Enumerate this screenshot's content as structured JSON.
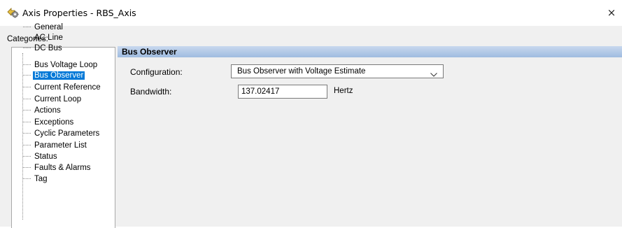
{
  "window": {
    "title": "Axis Properties - RBS_Axis",
    "close_glyph": "×",
    "icon": "axis-properties-icon"
  },
  "categories": {
    "label": "Categories:",
    "items": [
      {
        "label": "General",
        "selected": false
      },
      {
        "label": "AC Line",
        "selected": false
      },
      {
        "label": "DC Bus",
        "selected": false
      },
      {
        "label": "Bus Voltage Loop",
        "selected": false
      },
      {
        "label": "Bus Observer",
        "selected": true
      },
      {
        "label": "Current Reference",
        "selected": false
      },
      {
        "label": "Current Loop",
        "selected": false
      },
      {
        "label": "Actions",
        "selected": false
      },
      {
        "label": "Exceptions",
        "selected": false
      },
      {
        "label": "Cyclic Parameters",
        "selected": false
      },
      {
        "label": "Parameter List",
        "selected": false
      },
      {
        "label": "Status",
        "selected": false
      },
      {
        "label": "Faults & Alarms",
        "selected": false
      },
      {
        "label": "Tag",
        "selected": false
      }
    ]
  },
  "panel": {
    "title": "Bus Observer",
    "configuration": {
      "label": "Configuration:",
      "value": "Bus Observer with Voltage Estimate"
    },
    "bandwidth": {
      "label": "Bandwidth:",
      "value": "137.02417",
      "unit": "Hertz"
    }
  },
  "colors": {
    "selection": "#0078d7",
    "header_gradient_top": "#c8d8ee",
    "header_gradient_bottom": "#9fbce0",
    "dialog_bg": "#f0f0f0"
  }
}
